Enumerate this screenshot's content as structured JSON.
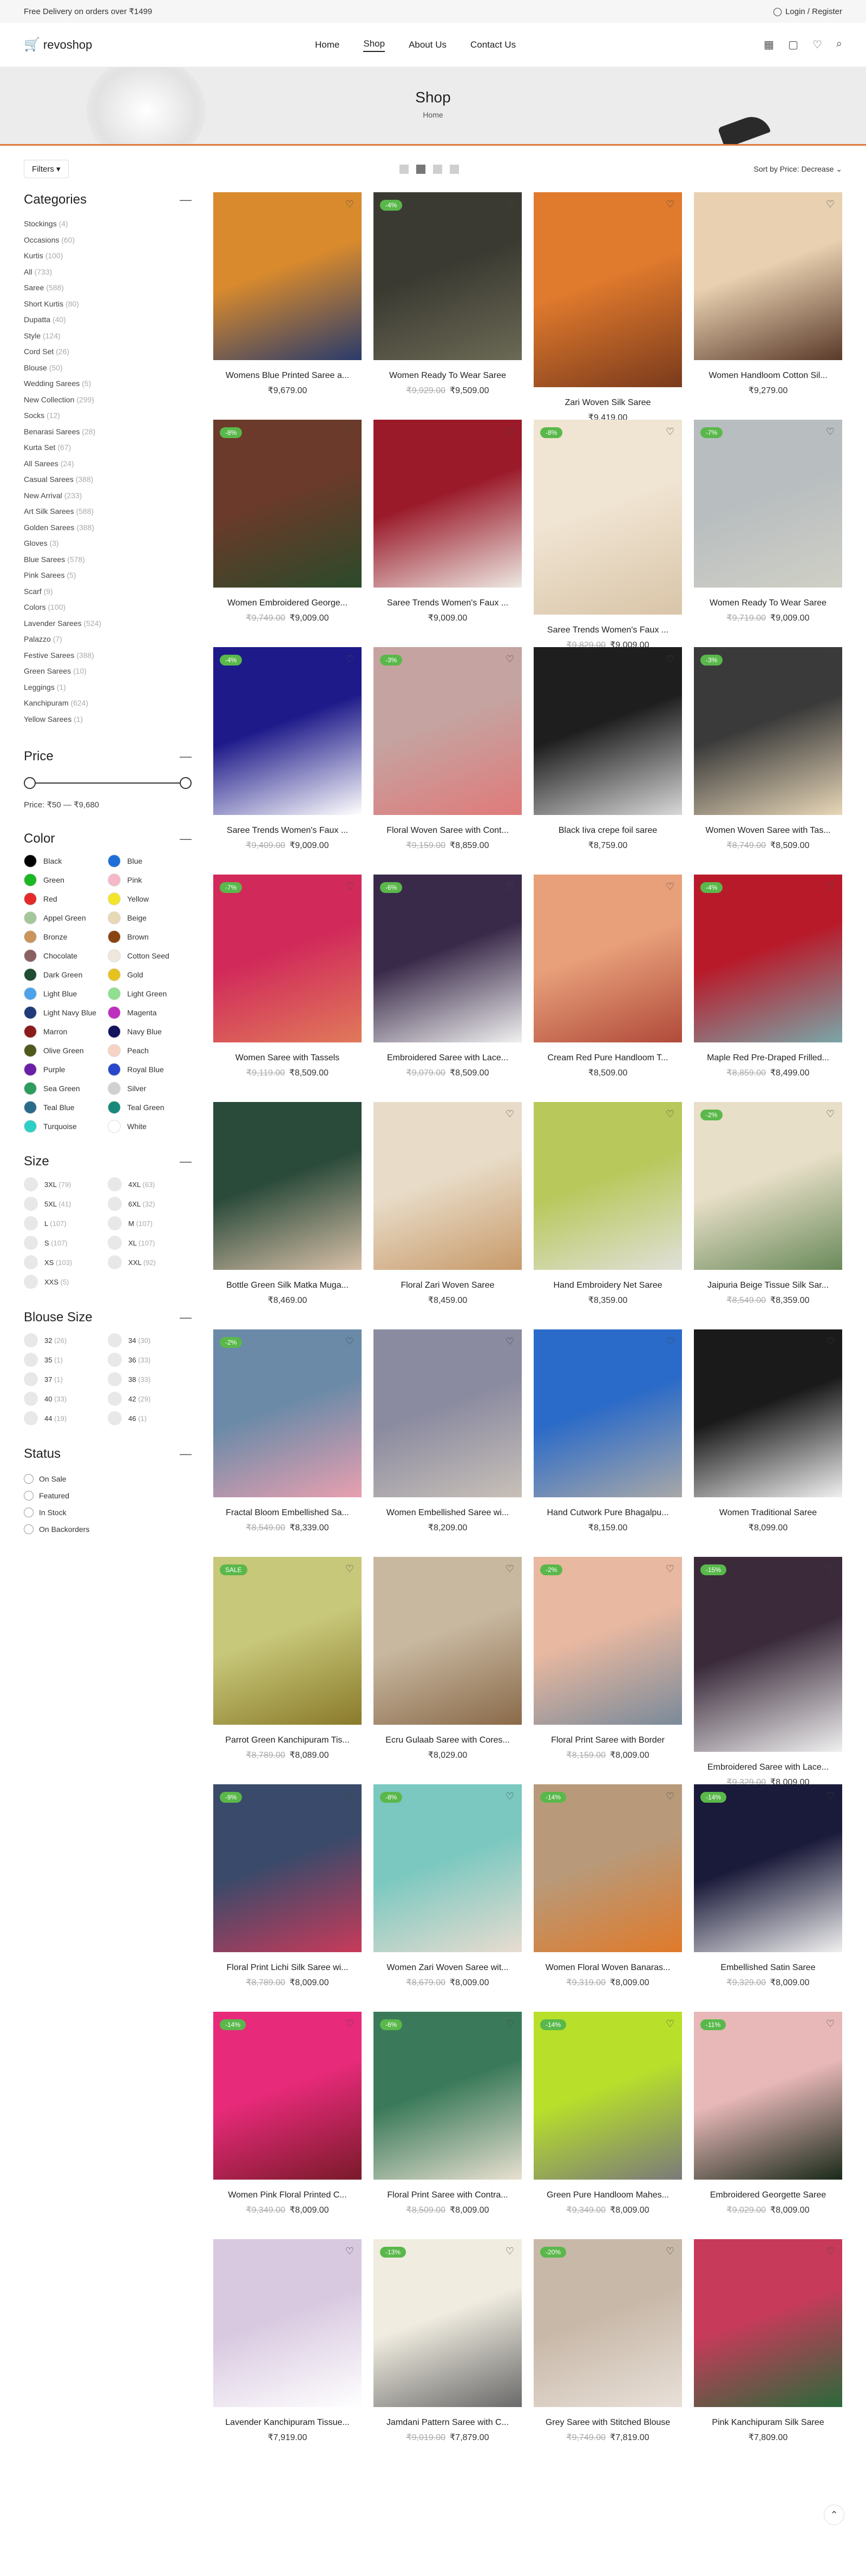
{
  "topbar": {
    "promo": "Free Delivery on orders over ₹1499",
    "login": "Login / Register"
  },
  "header": {
    "logo": "revoshop",
    "nav": [
      "Home",
      "Shop",
      "About Us",
      "Contact Us"
    ],
    "active_nav": "Shop"
  },
  "banner": {
    "title": "Shop",
    "breadcrumb": "Home"
  },
  "toolbar": {
    "filters": "Filters",
    "sort": "Sort by Price: Decrease"
  },
  "sidebar": {
    "categories_title": "Categories",
    "categories": [
      {
        "name": "Stockings",
        "count": "(4)"
      },
      {
        "name": "Occasions",
        "count": "(60)"
      },
      {
        "name": "Kurtis",
        "count": "(100)"
      },
      {
        "name": "All",
        "count": "(733)"
      },
      {
        "name": "Saree",
        "count": "(588)"
      },
      {
        "name": "Short Kurtis",
        "count": "(80)"
      },
      {
        "name": "Dupatta",
        "count": "(40)"
      },
      {
        "name": "Style",
        "count": "(124)"
      },
      {
        "name": "Cord Set",
        "count": "(26)"
      },
      {
        "name": "Blouse",
        "count": "(50)"
      },
      {
        "name": "Wedding Sarees",
        "count": "(5)"
      },
      {
        "name": "New Collection",
        "count": "(299)"
      },
      {
        "name": "Socks",
        "count": "(12)"
      },
      {
        "name": "Benarasi Sarees",
        "count": "(28)"
      },
      {
        "name": "Kurta Set",
        "count": "(67)"
      },
      {
        "name": "All Sarees",
        "count": "(24)"
      },
      {
        "name": "Casual Sarees",
        "count": "(388)"
      },
      {
        "name": "New Arrival",
        "count": "(233)"
      },
      {
        "name": "Art Silk Sarees",
        "count": "(588)"
      },
      {
        "name": "Golden Sarees",
        "count": "(388)"
      },
      {
        "name": "Gloves",
        "count": "(3)"
      },
      {
        "name": "Blue Sarees",
        "count": "(578)"
      },
      {
        "name": "Pink Sarees",
        "count": "(5)"
      },
      {
        "name": "Scarf",
        "count": "(9)"
      },
      {
        "name": "Colors",
        "count": "(100)"
      },
      {
        "name": "Lavender Sarees",
        "count": "(524)"
      },
      {
        "name": "Palazzo",
        "count": "(7)"
      },
      {
        "name": "Festive Sarees",
        "count": "(388)"
      },
      {
        "name": "Green Sarees",
        "count": "(10)"
      },
      {
        "name": "Leggings",
        "count": "(1)"
      },
      {
        "name": "Kanchipuram",
        "count": "(624)"
      },
      {
        "name": "Yellow Sarees",
        "count": "(1)"
      }
    ],
    "price_title": "Price",
    "price_range": "Price: ₹50 — ₹9,680",
    "color_title": "Color",
    "colors": [
      {
        "name": "Black",
        "hex": "#000000"
      },
      {
        "name": "Blue",
        "hex": "#1f6fd6"
      },
      {
        "name": "Green",
        "hex": "#1bb824"
      },
      {
        "name": "Pink",
        "hex": "#f6b7c6"
      },
      {
        "name": "Red",
        "hex": "#e52a2a"
      },
      {
        "name": "Yellow",
        "hex": "#f3e52a"
      },
      {
        "name": "Appel Green",
        "hex": "#a3c79a"
      },
      {
        "name": "Beige",
        "hex": "#e7d8b6"
      },
      {
        "name": "Bronze",
        "hex": "#c9955b"
      },
      {
        "name": "Brown",
        "hex": "#8a4412"
      },
      {
        "name": "Chocolate",
        "hex": "#8a6060"
      },
      {
        "name": "Cotton Seed",
        "hex": "#efe7dc"
      },
      {
        "name": "Dark Green",
        "hex": "#1f4d34"
      },
      {
        "name": "Gold",
        "hex": "#e6c21e"
      },
      {
        "name": "Light Blue",
        "hex": "#4da3ea"
      },
      {
        "name": "Light Green",
        "hex": "#8fe08f"
      },
      {
        "name": "Light Navy Blue",
        "hex": "#223a7a"
      },
      {
        "name": "Magenta",
        "hex": "#c02ec0"
      },
      {
        "name": "Marron",
        "hex": "#8a1c1c"
      },
      {
        "name": "Navy Blue",
        "hex": "#13135e"
      },
      {
        "name": "Olive Green",
        "hex": "#4e5a1c"
      },
      {
        "name": "Peach",
        "hex": "#f6d3c4"
      },
      {
        "name": "Purple",
        "hex": "#6a1fa8"
      },
      {
        "name": "Royal Blue",
        "hex": "#2846c9"
      },
      {
        "name": "Sea Green",
        "hex": "#2d9d5e"
      },
      {
        "name": "Silver",
        "hex": "#d0d0d0"
      },
      {
        "name": "Teal Blue",
        "hex": "#2a6b8a"
      },
      {
        "name": "Teal Green",
        "hex": "#16897a"
      },
      {
        "name": "Turquoise",
        "hex": "#2ecfc4"
      },
      {
        "name": "White",
        "hex": "#ffffff"
      }
    ],
    "size_title": "Size",
    "sizes": [
      {
        "name": "3XL",
        "count": "(79)"
      },
      {
        "name": "4XL",
        "count": "(63)"
      },
      {
        "name": "5XL",
        "count": "(41)"
      },
      {
        "name": "6XL",
        "count": "(32)"
      },
      {
        "name": "L",
        "count": "(107)"
      },
      {
        "name": "M",
        "count": "(107)"
      },
      {
        "name": "S",
        "count": "(107)"
      },
      {
        "name": "XL",
        "count": "(107)"
      },
      {
        "name": "XS",
        "count": "(103)"
      },
      {
        "name": "XXL",
        "count": "(92)"
      },
      {
        "name": "XXS",
        "count": "(5)"
      }
    ],
    "blouse_title": "Blouse Size",
    "blouse_sizes": [
      {
        "name": "32",
        "count": "(26)"
      },
      {
        "name": "34",
        "count": "(30)"
      },
      {
        "name": "35",
        "count": "(1)"
      },
      {
        "name": "36",
        "count": "(33)"
      },
      {
        "name": "37",
        "count": "(1)"
      },
      {
        "name": "38",
        "count": "(33)"
      },
      {
        "name": "40",
        "count": "(33)"
      },
      {
        "name": "42",
        "count": "(29)"
      },
      {
        "name": "44",
        "count": "(19)"
      },
      {
        "name": "46",
        "count": "(1)"
      }
    ],
    "status_title": "Status",
    "statuses": [
      "On Sale",
      "Featured",
      "In Stock",
      "On Backorders"
    ]
  },
  "products": [
    {
      "name": "Womens Blue Printed Saree a...",
      "old": "",
      "price": "₹9,679.00",
      "badge": "",
      "c1": "#d88a2d",
      "c2": "#2a3b6b"
    },
    {
      "name": "Women Ready To Wear Saree",
      "old": "₹9,929.00",
      "price": "₹9,509.00",
      "badge": "-4%",
      "c1": "#3b3a32",
      "c2": "#6b6a55"
    },
    {
      "name": "Zari Woven Silk Saree",
      "old": "",
      "price": "₹9,419.00",
      "badge": "",
      "c1": "#e07a2d",
      "c2": "#7a3a1c",
      "tall": true
    },
    {
      "name": "Women Handloom Cotton Sil...",
      "old": "",
      "price": "₹9,279.00",
      "badge": "",
      "c1": "#e8d0b0",
      "c2": "#5a3a2a"
    },
    {
      "name": "Women Embroidered George...",
      "old": "₹9,749.00",
      "price": "₹9,009.00",
      "badge": "-8%",
      "c1": "#6b3a2a",
      "c2": "#2b4a2a"
    },
    {
      "name": "Saree Trends Women's Faux ...",
      "old": "",
      "price": "₹9,009.00",
      "badge": "",
      "c1": "#9a1a2a",
      "c2": "#ede8e2"
    },
    {
      "name": "Saree Trends Women's Faux ...",
      "old": "₹9,829.00",
      "price": "₹9,009.00",
      "badge": "-8%",
      "c1": "#f0e4d2",
      "c2": "#d9c5a8",
      "tall": true
    },
    {
      "name": "Women Ready To Wear Saree",
      "old": "₹9,719.00",
      "price": "₹9,009.00",
      "badge": "-7%",
      "c1": "#b8bdbf",
      "c2": "#cfd0c6"
    },
    {
      "name": "Saree Trends Women's Faux ...",
      "old": "₹9,409.00",
      "price": "₹9,009.00",
      "badge": "-4%",
      "c1": "#1e1a8a",
      "c2": "#ffffff"
    },
    {
      "name": "Floral Woven Saree with Cont...",
      "old": "₹9,159.00",
      "price": "₹8,859.00",
      "badge": "-3%",
      "c1": "#c5a3a0",
      "c2": "#e07a7a"
    },
    {
      "name": "Black Iiva crepe foil saree",
      "old": "",
      "price": "₹8,759.00",
      "badge": "",
      "c1": "#1e1e1e",
      "c2": "#d8d8d8"
    },
    {
      "name": "Women Woven Saree with Tas...",
      "old": "₹8,749.00",
      "price": "₹8,509.00",
      "badge": "-3%",
      "c1": "#3a3a3a",
      "c2": "#e8d7b8"
    },
    {
      "name": "Women Saree with Tassels",
      "old": "₹9,119.00",
      "price": "₹8,509.00",
      "badge": "-7%",
      "c1": "#d12a5a",
      "c2": "#e07a5a"
    },
    {
      "name": "Embroidered Saree with Lace...",
      "old": "₹9,079.00",
      "price": "₹8,509.00",
      "badge": "-6%",
      "c1": "#3a2a4a",
      "c2": "#f0f0f0"
    },
    {
      "name": "Cream Red Pure Handloom T...",
      "old": "",
      "price": "₹8,509.00",
      "badge": "",
      "c1": "#e8a07a",
      "c2": "#b04a3a"
    },
    {
      "name": "Maple Red Pre-Draped Frilled...",
      "old": "₹8,859.00",
      "price": "₹8,499.00",
      "badge": "-4%",
      "c1": "#b81a2a",
      "c2": "#7aa6a8"
    },
    {
      "name": "Bottle Green Silk Matka Muga...",
      "old": "",
      "price": "₹8,469.00",
      "badge": "",
      "c1": "#2a4a3a",
      "c2": "#d8c0a8"
    },
    {
      "name": "Floral Zari Woven Saree",
      "old": "",
      "price": "₹8,459.00",
      "badge": "",
      "c1": "#e8dcc8",
      "c2": "#c89a6a"
    },
    {
      "name": "Hand Embroidery Net Saree",
      "old": "",
      "price": "₹8,359.00",
      "badge": "",
      "c1": "#b8c85a",
      "c2": "#e0e0d8"
    },
    {
      "name": "Jaipuria Beige Tissue Silk Sar...",
      "old": "₹8,549.00",
      "price": "₹8,359.00",
      "badge": "-2%",
      "c1": "#e8dfc8",
      "c2": "#6a8a5a"
    },
    {
      "name": "Fractal Bloom Embellished Sa...",
      "old": "₹8,549.00",
      "price": "₹8,339.00",
      "badge": "-2%",
      "c1": "#6a8aa8",
      "c2": "#e8a0b0"
    },
    {
      "name": "Women Embellished Saree wi...",
      "old": "",
      "price": "₹8,209.00",
      "badge": "",
      "c1": "#8a8aa0",
      "c2": "#c8c0b8"
    },
    {
      "name": "Hand Cutwork Pure Bhagalpu...",
      "old": "",
      "price": "₹8,159.00",
      "badge": "",
      "c1": "#2a6ac8",
      "c2": "#a8a8a8"
    },
    {
      "name": "Women Traditional Saree",
      "old": "",
      "price": "₹8,099.00",
      "badge": "",
      "c1": "#1a1a1a",
      "c2": "#f0f0f0"
    },
    {
      "name": "Parrot Green Kanchipuram Tis...",
      "old": "₹8,789.00",
      "price": "₹8,089.00",
      "badge": "SALE",
      "c1": "#c8c87a",
      "c2": "#8a7a2a"
    },
    {
      "name": "Ecru Gulaab Saree with Cores...",
      "old": "",
      "price": "₹8,029.00",
      "badge": "",
      "c1": "#c8b8a0",
      "c2": "#8a6a4a"
    },
    {
      "name": "Floral Print Saree with Border",
      "old": "₹8,159.00",
      "price": "₹8,009.00",
      "badge": "-2%",
      "c1": "#e8b8a0",
      "c2": "#7a8a9a"
    },
    {
      "name": "Embroidered Saree with Lace...",
      "old": "₹9,329.00",
      "price": "₹8,009.00",
      "badge": "-15%",
      "c1": "#3a2a3a",
      "c2": "#f0f0f0",
      "tall": true
    },
    {
      "name": "Floral Print Lichi Silk Saree wi...",
      "old": "₹8,789.00",
      "price": "₹8,009.00",
      "badge": "-9%",
      "c1": "#3a4a6a",
      "c2": "#c83a5a"
    },
    {
      "name": "Women Zari Woven Saree wit...",
      "old": "₹8,679.00",
      "price": "₹8,009.00",
      "badge": "-8%",
      "c1": "#7ac8c0",
      "c2": "#e8dcd0"
    },
    {
      "name": "Women Floral Woven Banaras...",
      "old": "₹9,319.00",
      "price": "₹8,009.00",
      "badge": "-14%",
      "c1": "#b89a7a",
      "c2": "#e07a2a"
    },
    {
      "name": "Embellished Satin Saree",
      "old": "₹9,329.00",
      "price": "₹8,009.00",
      "badge": "-14%",
      "c1": "#1a1a3a",
      "c2": "#f0f0f0"
    },
    {
      "name": "Women Pink Floral Printed C...",
      "old": "₹9,349.00",
      "price": "₹8,009.00",
      "badge": "-14%",
      "c1": "#e82a7a",
      "c2": "#7a1a2a"
    },
    {
      "name": "Floral Print Saree with Contra...",
      "old": "₹8,509.00",
      "price": "₹8,009.00",
      "badge": "-6%",
      "c1": "#3a7a5a",
      "c2": "#e8e0d0"
    },
    {
      "name": "Green Pure Handloom Mahes...",
      "old": "₹9,349.00",
      "price": "₹8,009.00",
      "badge": "-14%",
      "c1": "#b8e02a",
      "c2": "#7a7a7a"
    },
    {
      "name": "Embroidered Georgette Saree",
      "old": "₹9,029.00",
      "price": "₹8,009.00",
      "badge": "-11%",
      "c1": "#e8b8b8",
      "c2": "#1a2a1a"
    },
    {
      "name": "Lavender Kanchipuram Tissue...",
      "old": "",
      "price": "₹7,919.00",
      "badge": "",
      "c1": "#d8c8e0",
      "c2": "#ffffff"
    },
    {
      "name": "Jamdani Pattern Saree with C...",
      "old": "₹9,019.00",
      "price": "₹7,879.00",
      "badge": "-13%",
      "c1": "#f0ece0",
      "c2": "#6a6a6a"
    },
    {
      "name": "Grey Saree with Stitched Blouse",
      "old": "₹9,749.00",
      "price": "₹7,819.00",
      "badge": "-20%",
      "c1": "#c8b8a8",
      "c2": "#e8e0d8"
    },
    {
      "name": "Pink Kanchipuram Silk Saree",
      "old": "",
      "price": "₹7,809.00",
      "badge": "",
      "c1": "#c83a5a",
      "c2": "#2a6a3a"
    }
  ]
}
